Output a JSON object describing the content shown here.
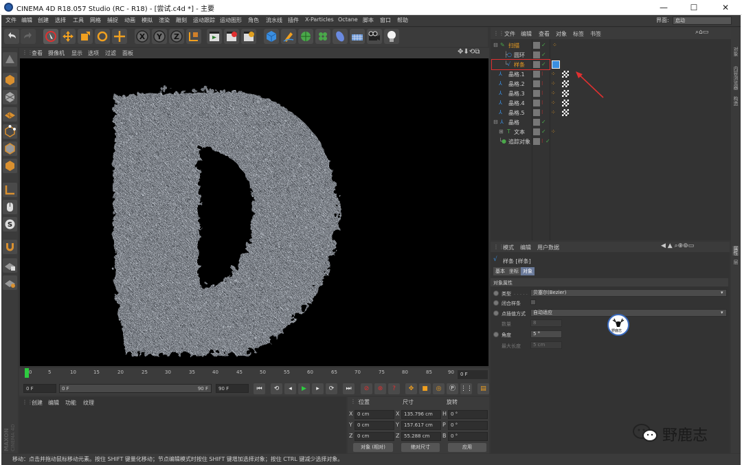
{
  "window": {
    "title": "CINEMA 4D R18.057 Studio (RC - R18) - [尝试.c4d *] - 主要",
    "minimize": "—",
    "maximize": "☐",
    "close": "✕"
  },
  "menubar": {
    "items": [
      "文件",
      "编辑",
      "创建",
      "选择",
      "工具",
      "网格",
      "捕捉",
      "动画",
      "模拟",
      "渲染",
      "雕刻",
      "运动跟踪",
      "运动图形",
      "角色",
      "流水线",
      "插件",
      "X-Particles",
      "Octane",
      "脚本",
      "窗口",
      "帮助"
    ],
    "layout_label": "界面:",
    "layout_value": "启动"
  },
  "viewport": {
    "menus": [
      "查看",
      "摄像机",
      "显示",
      "选项",
      "过滤",
      "面板"
    ]
  },
  "timeline": {
    "ticks": [
      "0",
      "5",
      "10",
      "15",
      "20",
      "25",
      "30",
      "35",
      "40",
      "45",
      "50",
      "55",
      "60",
      "65",
      "70",
      "75",
      "80",
      "85",
      "90"
    ],
    "current_frame": "0 F"
  },
  "transport": {
    "start_field": "0 F",
    "slider_start": "0 F",
    "slider_end": "90 F",
    "end_field": "90 F"
  },
  "material_manager": {
    "menus": [
      "创建",
      "编辑",
      "功能",
      "纹理"
    ],
    "brand": "MAXON CINEMA 4D"
  },
  "coordinates": {
    "headers": [
      "位置",
      "尺寸",
      "旋转"
    ],
    "rows": [
      {
        "axis": "X",
        "pos": "0 cm",
        "size_axis": "X",
        "size": "135.796 cm",
        "rot_axis": "H",
        "rot": "0 °"
      },
      {
        "axis": "Y",
        "pos": "0 cm",
        "size_axis": "Y",
        "size": "157.617 cm",
        "rot_axis": "P",
        "rot": "0 °"
      },
      {
        "axis": "Z",
        "pos": "0 cm",
        "size_axis": "Z",
        "size": "55.288 cm",
        "rot_axis": "B",
        "rot": "0 °"
      }
    ],
    "mode_select": "对象 (相对)",
    "size_select": "绝对尺寸",
    "apply_button": "应用"
  },
  "status_bar": "移动：点击并拖动鼠标移动元素。按住 SHIFT 键量化移动；节点编辑模式时按住 SHIFT 键增加选择对象；按住 CTRL 键减少选择对象。",
  "object_manager": {
    "menus": [
      "文件",
      "编辑",
      "查看",
      "对象",
      "标签",
      "书签"
    ],
    "objects": [
      {
        "name": "扫描",
        "color": "#f0a020"
      },
      {
        "name": "圆环",
        "color": "#d0d0d0"
      },
      {
        "name": "样条",
        "color": "#f0a020"
      },
      {
        "name": "晶格.1",
        "color": "#d0d0d0"
      },
      {
        "name": "晶格.2",
        "color": "#d0d0d0"
      },
      {
        "name": "晶格.3",
        "color": "#d0d0d0"
      },
      {
        "name": "晶格.4",
        "color": "#d0d0d0"
      },
      {
        "name": "晶格.5",
        "color": "#d0d0d0"
      },
      {
        "name": "晶格",
        "color": "#d0d0d0"
      },
      {
        "name": "文本",
        "color": "#d0d0d0"
      },
      {
        "name": "追踪对象",
        "color": "#d0d0d0"
      }
    ]
  },
  "right_tabs": [
    "对象",
    "内容浏览器",
    "构造"
  ],
  "right_tabs_lower": [
    "属性",
    "层"
  ],
  "attribute_manager": {
    "menus": [
      "模式",
      "编辑",
      "用户数据"
    ],
    "object_title": "样条 [样条]",
    "tabs": [
      "基本",
      "坐标",
      "对象"
    ],
    "section": "对象属性",
    "type_label": "类型",
    "type_value": "贝塞尔(Bezier)",
    "closed_label": "闭合样条",
    "interp_label": "点插值方式",
    "interp_value": "自动适应",
    "number_label": "数量",
    "number_value": "8",
    "angle_label": "角度",
    "angle_value": "5 °",
    "maxlen_label": "最大长度",
    "maxlen_value": "5 cm"
  },
  "watermark": {
    "badge_text": "野鹿志",
    "text": "野鹿志"
  },
  "colors": {
    "accent_orange": "#f0a020",
    "highlight_red": "#e03030",
    "play_green": "#2ecc40"
  }
}
